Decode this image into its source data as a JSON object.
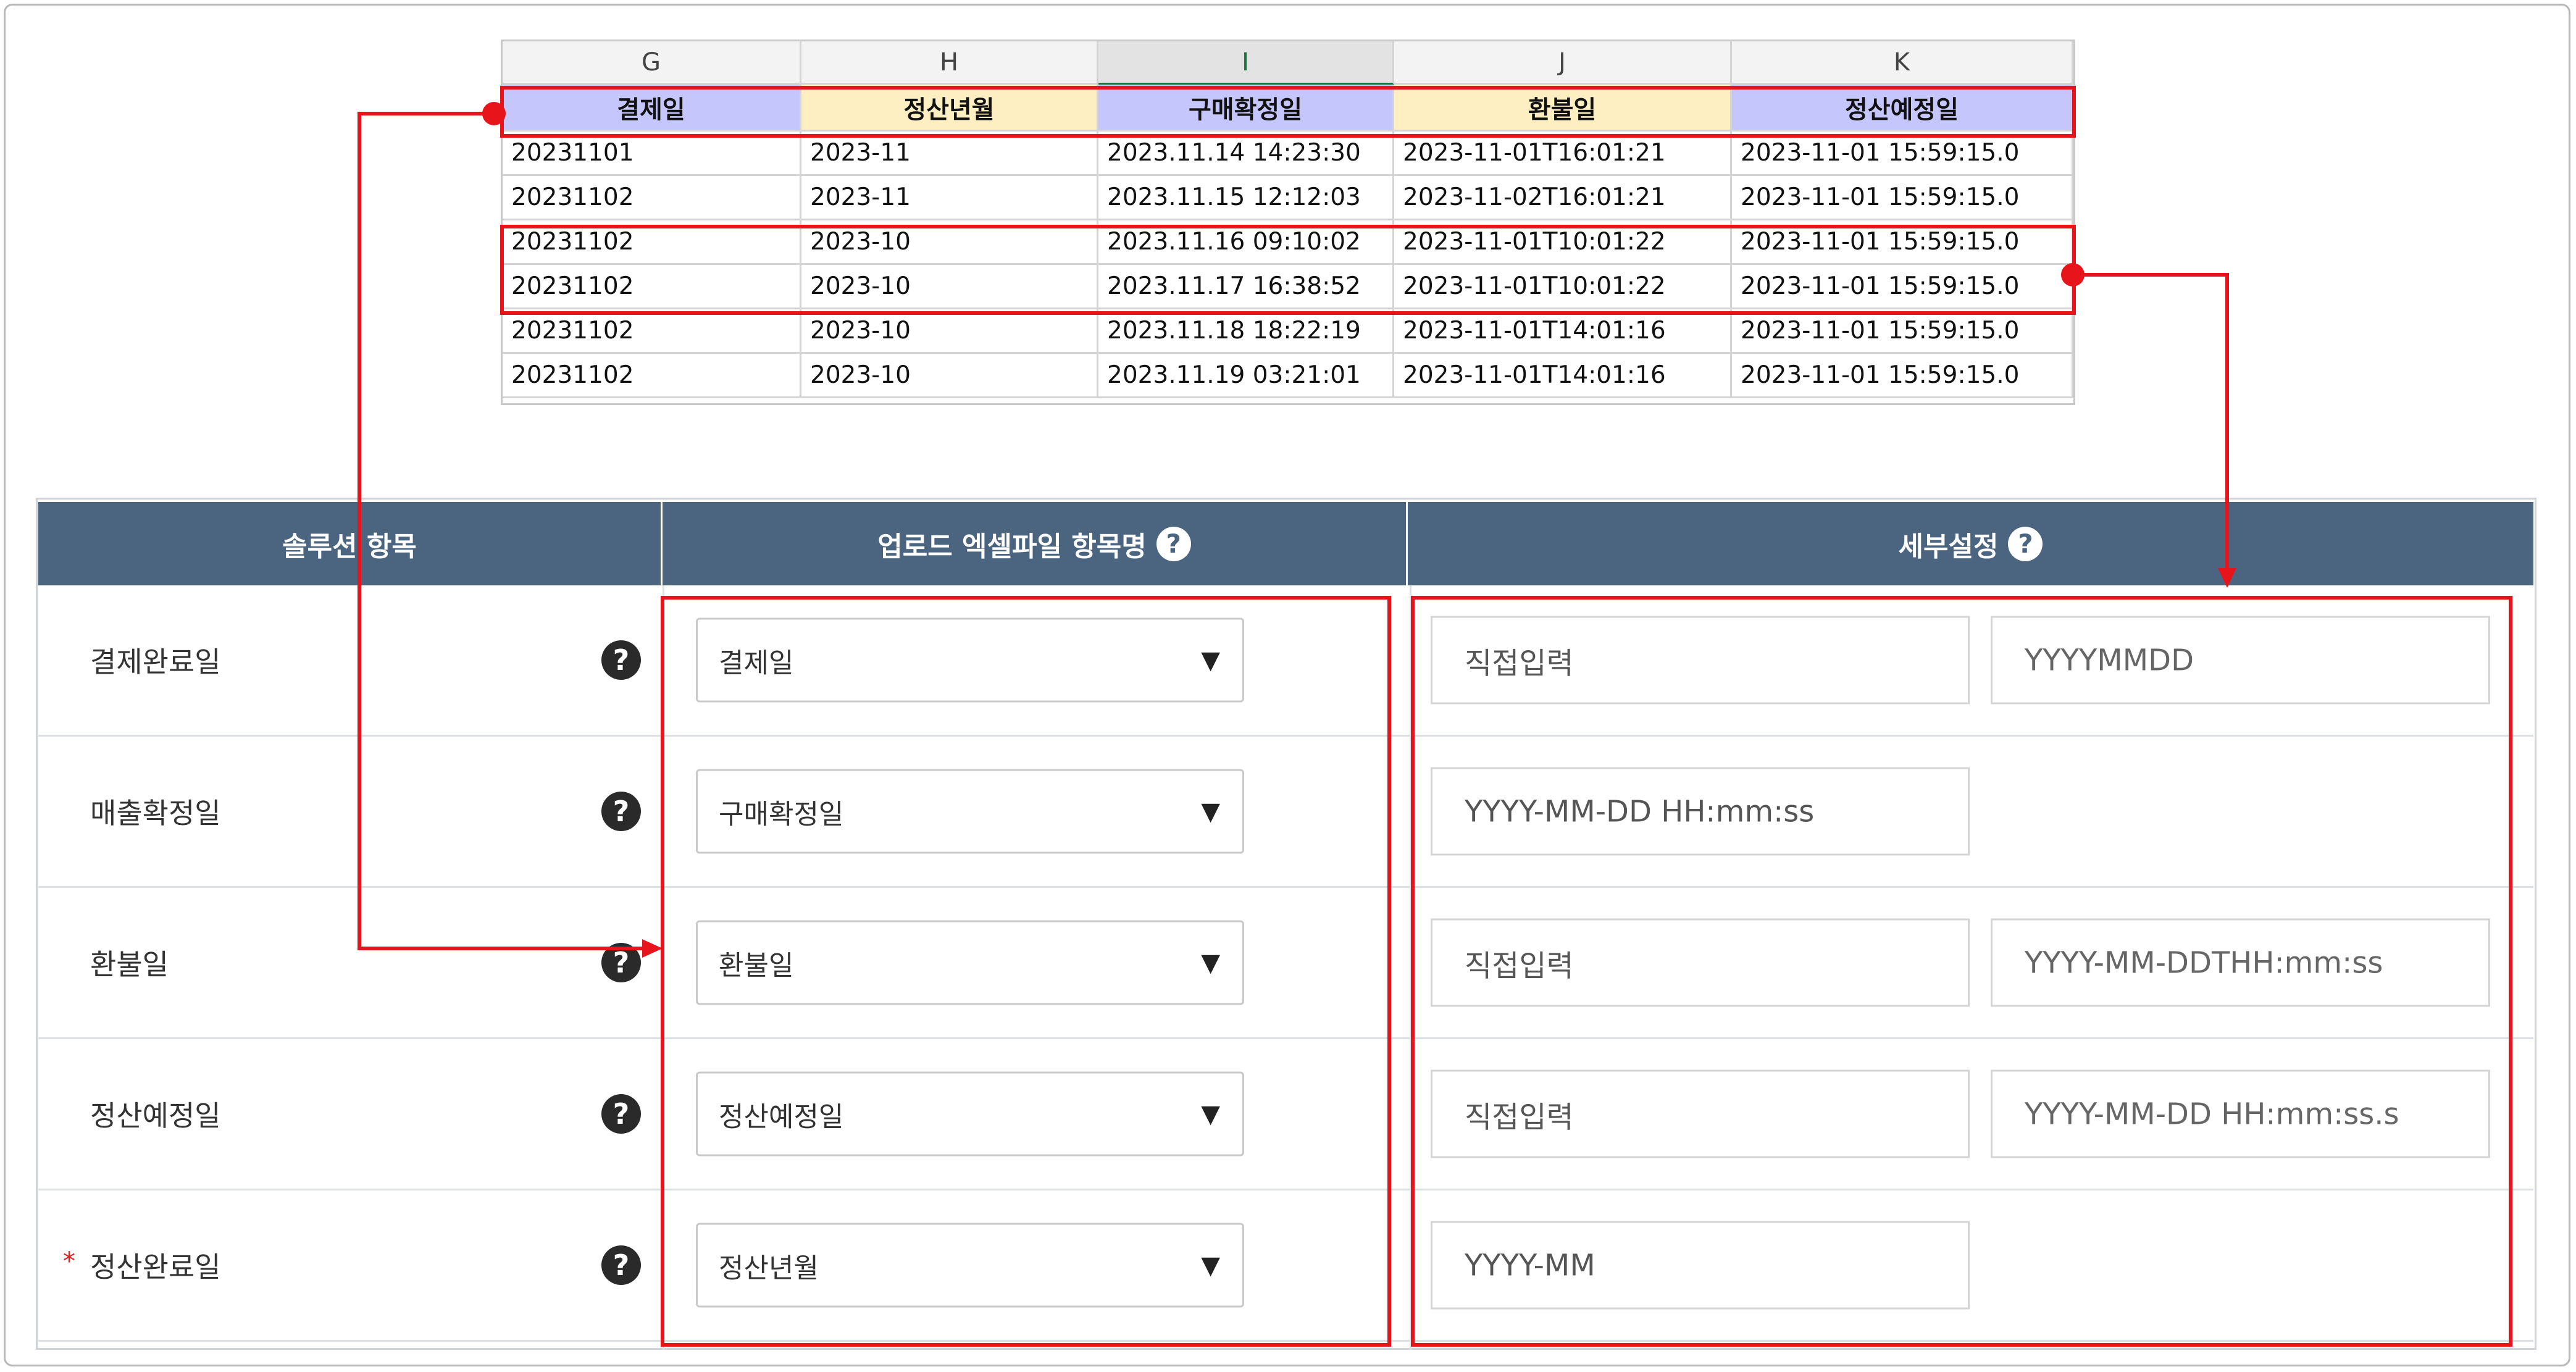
{
  "spreadsheet": {
    "columns": [
      "G",
      "H",
      "I",
      "J",
      "K"
    ],
    "active_column": "I",
    "headers": [
      "결제일",
      "정산년월",
      "구매확정일",
      "환불일",
      "정산예정일"
    ],
    "header_colors": [
      "#c5c6fc",
      "#fdefc2",
      "#c5c6fc",
      "#fdefc2",
      "#c5c6fc"
    ],
    "rows": [
      [
        "20231101",
        "2023-11",
        "2023.11.14 14:23:30",
        "2023-11-01T16:01:21",
        "2023-11-01 15:59:15.0"
      ],
      [
        "20231102",
        "2023-11",
        "2023.11.15 12:12:03",
        "2023-11-02T16:01:21",
        "2023-11-01 15:59:15.0"
      ],
      [
        "20231102",
        "2023-10",
        "2023.11.16 09:10:02",
        "2023-11-01T10:01:22",
        "2023-11-01 15:59:15.0"
      ],
      [
        "20231102",
        "2023-10",
        "2023.11.17 16:38:52",
        "2023-11-01T10:01:22",
        "2023-11-01 15:59:15.0"
      ],
      [
        "20231102",
        "2023-10",
        "2023.11.18 18:22:19",
        "2023-11-01T14:01:16",
        "2023-11-01 15:59:15.0"
      ],
      [
        "20231102",
        "2023-10",
        "2023.11.19 03:21:01",
        "2023-11-01T14:01:16",
        "2023-11-01 15:59:15.0"
      ]
    ]
  },
  "settings": {
    "headers": {
      "solution_item": "솔루션 항목",
      "upload_column": "업로드 엑셀파일 항목명",
      "detail": "세부설정"
    },
    "help_glyph": "?",
    "dropdown_arrow": "▼",
    "rows": [
      {
        "label": "결제완료일",
        "required": false,
        "select": "결제일",
        "input1": "직접입력",
        "input2": "YYYYMMDD"
      },
      {
        "label": "매출확정일",
        "required": false,
        "select": "구매확정일",
        "input1": "YYYY-MM-DD HH:mm:ss",
        "input2": null
      },
      {
        "label": "환불일",
        "required": false,
        "select": "환불일",
        "input1": "직접입력",
        "input2": "YYYY-MM-DDTHH:mm:ss"
      },
      {
        "label": "정산예정일",
        "required": false,
        "select": "정산예정일",
        "input1": "직접입력",
        "input2": "YYYY-MM-DD HH:mm:ss.s"
      },
      {
        "label": "정산완료일",
        "required": true,
        "select": "정산년월",
        "input1": "YYYY-MM",
        "input2": null
      }
    ],
    "required_mark": "*"
  },
  "annotation_color": "#e8141b"
}
